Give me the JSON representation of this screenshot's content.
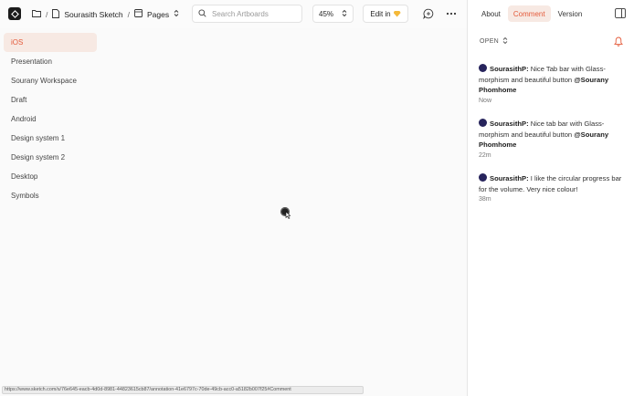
{
  "topbar": {
    "folder_icon": "folder-icon",
    "project_name": "Sourasith Sketch",
    "pages_label": "Pages",
    "search_placeholder": "Search Artboards",
    "zoom_value": "45%",
    "edit_in_label": "Edit in"
  },
  "pages": [
    {
      "label": "iOS",
      "active": true
    },
    {
      "label": "Presentation",
      "active": false
    },
    {
      "label": "Sourany Workspace",
      "active": false
    },
    {
      "label": "Draft",
      "active": false
    },
    {
      "label": "Android",
      "active": false
    },
    {
      "label": "Design system 1",
      "active": false
    },
    {
      "label": "Design system 2",
      "active": false
    },
    {
      "label": "Desktop",
      "active": false
    },
    {
      "label": "Symbols",
      "active": false
    }
  ],
  "right_panel": {
    "tabs": [
      "About",
      "Comment",
      "Version"
    ],
    "active_tab": "Comment",
    "filter_label": "OPEN",
    "comments": [
      {
        "author": "SourasithP:",
        "text": " Nice Tab bar with Glass-morphism and beautiful button ",
        "mention": "@Sourany Phomhome",
        "time": "Now"
      },
      {
        "author": "SourasithP:",
        "text": " Nice tab bar with Glass-morphism and beautiful button ",
        "mention": "@Sourany Phomhome",
        "time": "22m"
      },
      {
        "author": "SourasithP:",
        "text": " I like the circular progress bar for the volume. Very nice colour!",
        "mention": "",
        "time": "38m"
      }
    ]
  },
  "status_url": "https://www.sketch.com/s/76e645-eacb-4d0d-8981-44823615cb87/annotation-41e6797c-70de-49cb-acc0-a5182b007f25#Comment",
  "colors": {
    "accent": "#e45a3a",
    "accent_bg": "#f7e9e3",
    "avatar": "#27245c",
    "gem": "#f4b93a"
  }
}
